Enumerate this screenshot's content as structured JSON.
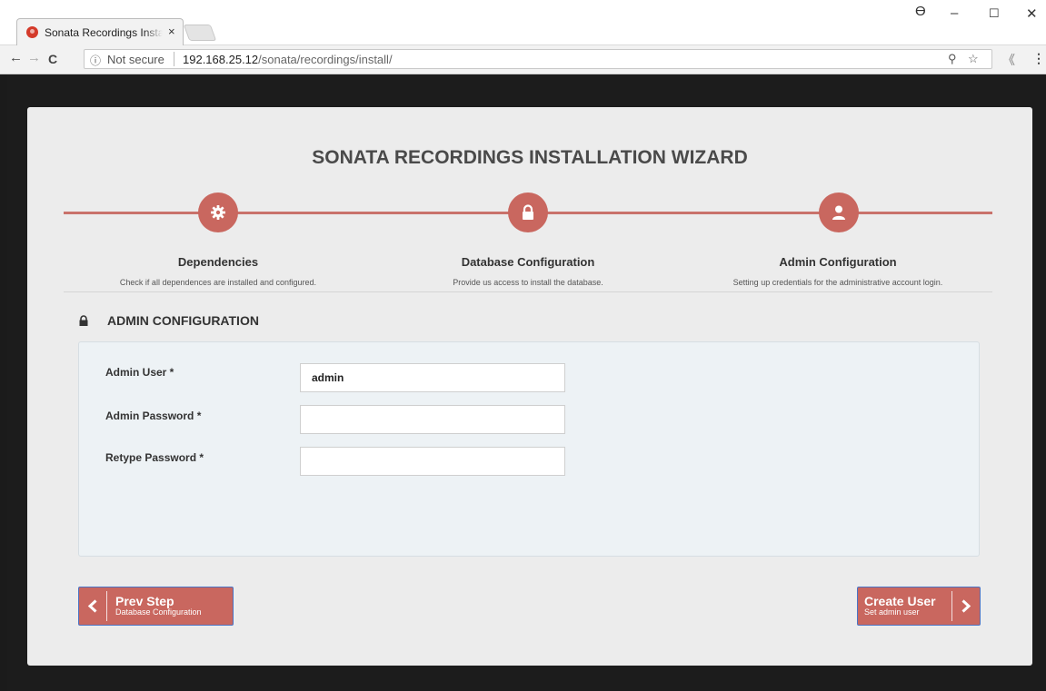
{
  "browser": {
    "tab_title": "Sonata Recordings Install",
    "tab_close": "×",
    "back": "←",
    "forward": "→",
    "reload": "C",
    "info_icon": "ⓘ",
    "security": "Not secure",
    "url_host": "192.168.25.12",
    "url_path": "/sonata/recordings/install/",
    "window_minimize": "–",
    "window_maximize": "☐",
    "window_close": "✕",
    "profile_icon": "ϴ",
    "key_icon": "⚲",
    "bookmark_icon": "☆",
    "extension_icon": "《",
    "menu_icon": "⋮"
  },
  "wizard": {
    "title": "SONATA RECORDINGS INSTALLATION WIZARD",
    "accent_color": "#c9675f",
    "steps": [
      {
        "title": "Dependencies",
        "desc": "Check if all dependences are installed and configured.",
        "icon": "gear-icon"
      },
      {
        "title": "Database Configuration",
        "desc": "Provide us access to install the database.",
        "icon": "lock-icon"
      },
      {
        "title": "Admin Configuration",
        "desc": "Setting up credentials for the administrative account login.",
        "icon": "user-icon"
      }
    ]
  },
  "section": {
    "title": "ADMIN CONFIGURATION",
    "icon": "lock-icon"
  },
  "form": {
    "admin_user": {
      "label": "Admin User *",
      "value": "admin"
    },
    "admin_password": {
      "label": "Admin Password *",
      "value": ""
    },
    "retype_password": {
      "label": "Retype Password *",
      "value": ""
    }
  },
  "buttons": {
    "prev": {
      "label": "Prev Step",
      "sub": "Database Configuration"
    },
    "next": {
      "label": "Create User",
      "sub": "Set admin user"
    }
  }
}
